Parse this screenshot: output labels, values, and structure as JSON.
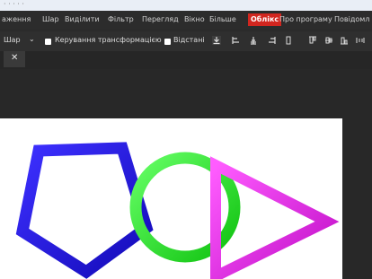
{
  "menu": {
    "items": [
      {
        "label": "аження"
      },
      {
        "label": "Шар"
      },
      {
        "label": "Виділити"
      },
      {
        "label": "Фільтр"
      },
      {
        "label": "Перегляд"
      },
      {
        "label": "Вікно"
      },
      {
        "label": "Більше"
      },
      {
        "label": "Облікс"
      },
      {
        "label": "Про програму"
      },
      {
        "label": "Повідомл"
      }
    ]
  },
  "toolbar": {
    "tool": "Шар",
    "transform_label": "Керування трансформацією",
    "distances_label": "Відстані"
  },
  "tab": {
    "close": "✕"
  },
  "colors": {
    "menu_bg": "#2c2c2c",
    "active_menu": "#d2261f",
    "canvas": "#ffffff",
    "pentagon": "#1f12e0",
    "circle": "#22f021",
    "triangle": "#e01be6"
  }
}
